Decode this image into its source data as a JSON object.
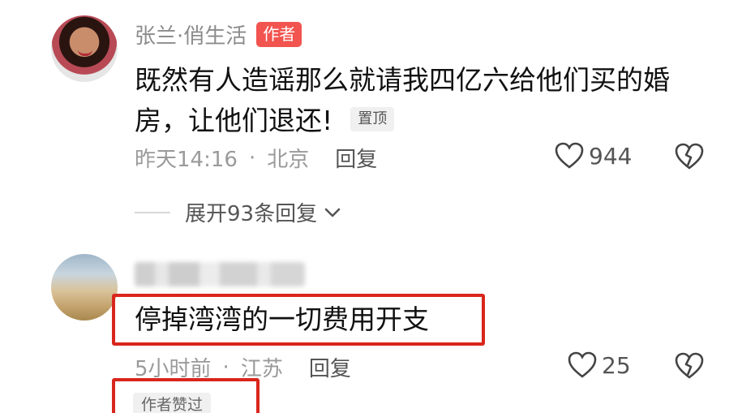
{
  "comments": [
    {
      "username": "张兰·俏生活",
      "author_badge": "作者",
      "text": "既然有人造谣那么就请我四亿六给他们买的婚房，让他们退还!",
      "pin_badge": "置顶",
      "time": "昨天14:16",
      "separator": "·",
      "location": "北京",
      "reply_label": "回复",
      "likes": "944",
      "expand_replies": "展开93条回复"
    },
    {
      "text": "停掉湾湾的一切费用开支",
      "time": "5小时前",
      "separator": "·",
      "location": "江苏",
      "reply_label": "回复",
      "likes": "25",
      "liked_badge": "作者赞过"
    }
  ],
  "colors": {
    "author_badge_bg": "#f2544f",
    "highlight_border": "#d9261c"
  }
}
